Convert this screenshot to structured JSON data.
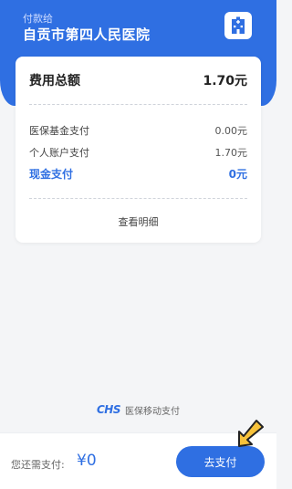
{
  "header": {
    "payee_label": "付款给",
    "payee_name": "自贡市第四人民医院",
    "icon": "hospital-building-icon"
  },
  "summary": {
    "total_label": "费用总额",
    "total_amount": "1.70元",
    "rows": [
      {
        "label": "医保基金支付",
        "value": "0.00元"
      },
      {
        "label": "个人账户支付",
        "value": "1.70元"
      },
      {
        "label": "现金支付",
        "value": "0元"
      }
    ],
    "details_link": "查看明细"
  },
  "brand": {
    "logo": "CHS",
    "text": "医保移动支付"
  },
  "footer": {
    "need_pay_label": "您还需支付:",
    "need_pay_amount": "¥0",
    "pay_button": "去支付"
  },
  "colors": {
    "primary": "#2f6fe2",
    "background": "#f4f5f7",
    "cursor": "#f7c23b"
  }
}
